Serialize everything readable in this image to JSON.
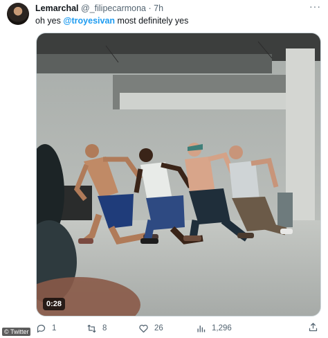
{
  "tweet": {
    "display_name": "Lemarchal",
    "handle": "@_filipecarmona",
    "separator": "·",
    "time": "7h",
    "text_prefix": "oh yes",
    "mention": "@troyesivan",
    "text_suffix": "most definitely yes"
  },
  "media": {
    "type": "video",
    "duration": "0:28"
  },
  "actions": {
    "replies": "1",
    "reposts": "8",
    "likes": "26",
    "views": "1,296"
  },
  "watermark": "© Twitter",
  "colors": {
    "mention": "#1d9bf0",
    "secondary_text": "#536471"
  }
}
